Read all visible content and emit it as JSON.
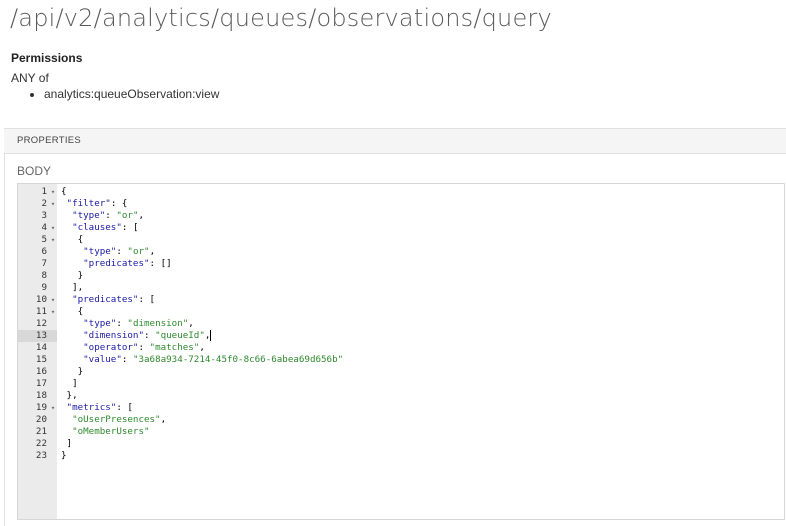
{
  "page": {
    "path": "/api/v2/analytics/queues/observations/query"
  },
  "permissions": {
    "heading": "Permissions",
    "qualifier": "ANY of",
    "items": [
      "analytics:queueObservation:view"
    ]
  },
  "properties": {
    "header": "PROPERTIES",
    "body_label": "BODY"
  },
  "editor": {
    "active_line": 13,
    "fold_lines": [
      1,
      2,
      4,
      5,
      10,
      11,
      19
    ],
    "lines": [
      "{",
      " \"filter\": {",
      "  \"type\": \"or\",",
      "  \"clauses\": [",
      "   {",
      "    \"type\": \"or\",",
      "    \"predicates\": []",
      "   }",
      "  ],",
      "  \"predicates\": [",
      "   {",
      "    \"type\": \"dimension\",",
      "    \"dimension\": \"queueId\",",
      "    \"operator\": \"matches\",",
      "    \"value\": \"3a68a934-7214-45f0-8c66-6abea69d656b\"",
      "   }",
      "  ]",
      " },",
      " \"metrics\": [",
      "  \"oUserPresences\",",
      "  \"oMemberUsers\"",
      " ]",
      "}"
    ]
  }
}
